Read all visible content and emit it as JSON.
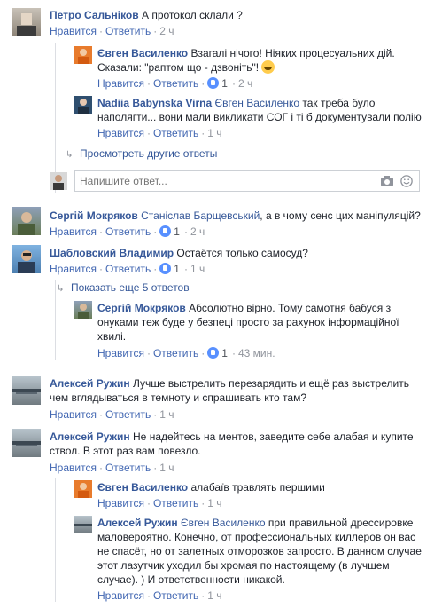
{
  "labels": {
    "like": "Нравится",
    "reply": "Ответить",
    "sep": "·"
  },
  "comments": [
    {
      "name": "Петро Сальніков",
      "text": "А протокол склали ?",
      "time": "2 ч"
    },
    {
      "name": "Євген Василенко",
      "text": "Взагалі нічого! Ніяких процесуальних дій. Сказали: \"раптом що - дзвоніть\"!",
      "time": "2 ч"
    },
    {
      "name": "Nadiia Babynska Virna",
      "mention": "Євген Василенко",
      "text": "так треба було наполягти... вони мали викликати СОГ і ті б документували полію",
      "time": "1 ч"
    },
    {
      "name": "Сергій Мокряков",
      "mention": "Станіслав Барщевський",
      "text": ", а в чому сенс цих маніпуляцій?",
      "likes": "1",
      "time": "2 ч"
    },
    {
      "name": "Шабловский Владимир",
      "text": "Остаётся только самосуд?",
      "likes": "1",
      "time": "1 ч"
    },
    {
      "name": "Сергій Мокряков",
      "text": "Абсолютно вірно. Тому самотня бабуся з онуками теж буде у безпеці просто за рахунок інформаційної хвилі.",
      "likes": "1",
      "time": "43 мин."
    },
    {
      "name": "Алексей Ружин",
      "text": "Лучше выстрелить перезарядить и ещё раз выстрелить чем вглядываться в темноту и спрашивать кто там?",
      "time": "1 ч"
    },
    {
      "name": "Алексей Ружин",
      "text": "Не надейтесь на ментов, заведите себе алабая и купите ствол. В этот раз вам повезло.",
      "time": "1 ч"
    },
    {
      "name": "Євген Василенко",
      "text": "алабаїв травлять першими",
      "time": "1 ч"
    },
    {
      "name": "Алексей Ружин",
      "mention": "Євген Василенко",
      "text": "при правильной дрессировке маловероятно. Конечно, от профессиональных киллеров он вас не спасёт, но от залетных отморозков запросто. В данном случае этот лазутчик уходил бы хромая по настоящему (в лучшем случае). ) И ответственности никакой.",
      "time": "1 ч"
    }
  ],
  "more_replies": {
    "other": "Просмотреть другие ответы",
    "five": "Показать еще 5 ответов"
  },
  "reply_input": {
    "placeholder": "Напишите ответ..."
  },
  "icons": {
    "camera": "camera-icon",
    "emoji": "emoji-icon",
    "arrow": "reply-arrow-icon"
  }
}
